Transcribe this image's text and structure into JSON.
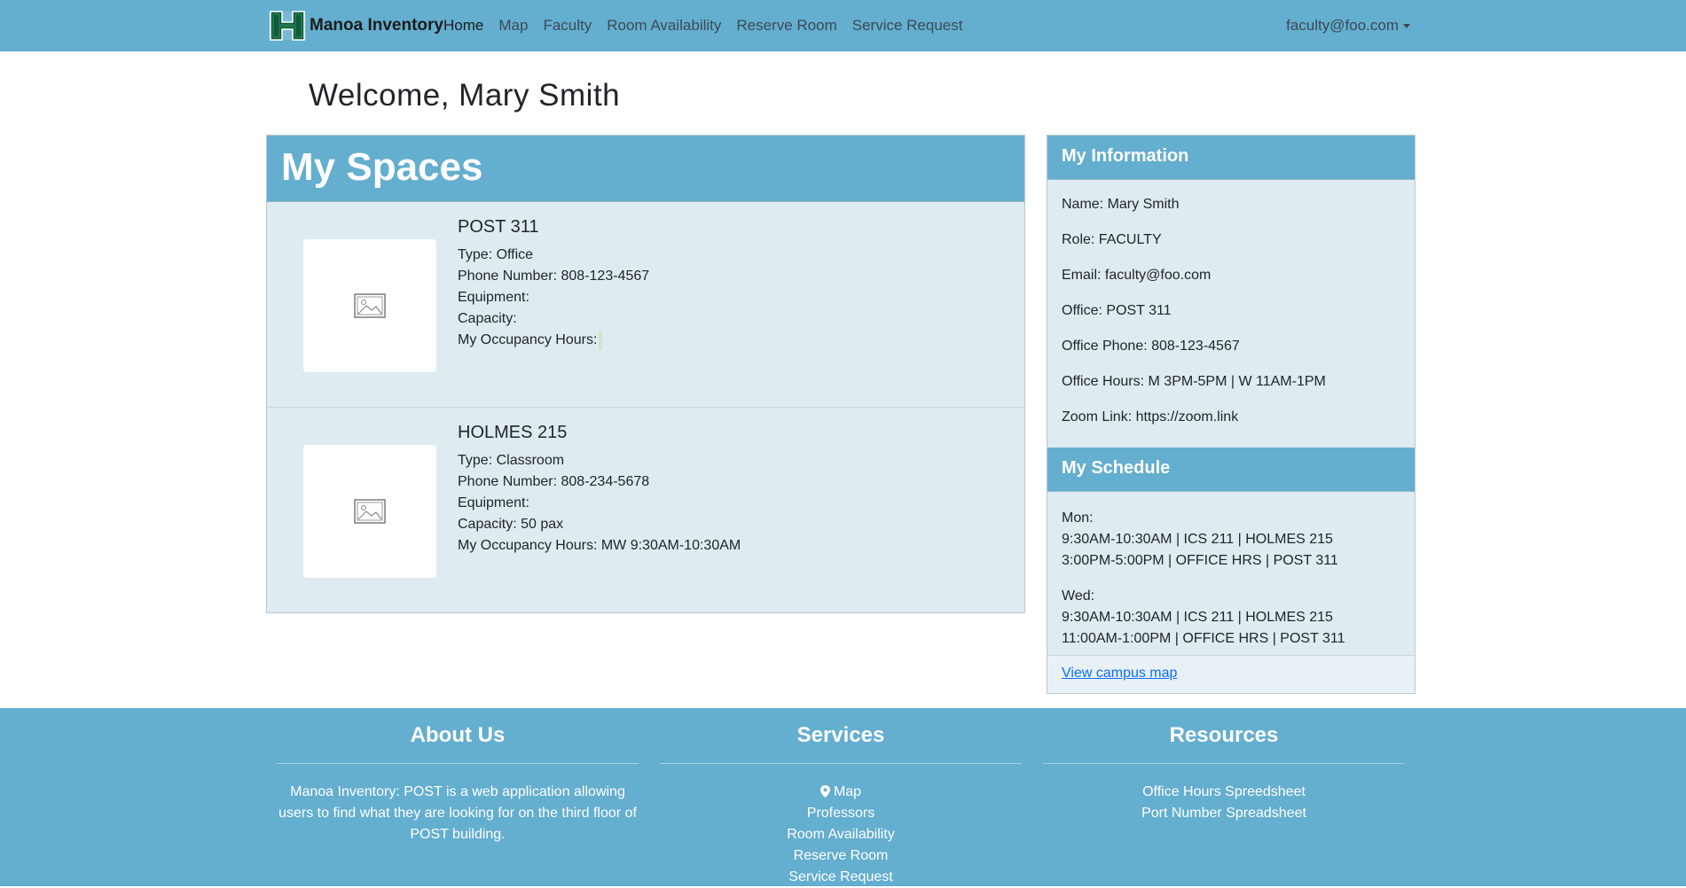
{
  "navbar": {
    "brand": "Manoa Inventory",
    "links": [
      "Home",
      "Map",
      "Faculty",
      "Room Availability",
      "Reserve Room",
      "Service Request"
    ],
    "user": "faculty@foo.com"
  },
  "welcome": "Welcome, Mary Smith",
  "spaces": {
    "title": "My Spaces",
    "items": [
      {
        "name": "POST 311",
        "type": "Type: Office",
        "phone": "Phone Number: 808-123-4567",
        "equipment": "Equipment:",
        "capacity": "Capacity:",
        "hours": "My Occupancy Hours:"
      },
      {
        "name": "HOLMES 215",
        "type": "Type: Classroom",
        "phone": "Phone Number: 808-234-5678",
        "equipment": "Equipment:",
        "capacity": "Capacity: 50 pax",
        "hours": "My Occupancy Hours: MW 9:30AM-10:30AM"
      }
    ]
  },
  "info": {
    "title": "My Information",
    "rows": [
      "Name: Mary Smith",
      "Role: FACULTY",
      "Email: faculty@foo.com",
      "Office: POST 311",
      "Office Phone: 808-123-4567",
      "Office Hours: M 3PM-5PM | W 11AM-1PM",
      "Zoom Link: https://zoom.link"
    ]
  },
  "schedule": {
    "title": "My Schedule",
    "days": [
      {
        "day": "Mon:",
        "lines": [
          "9:30AM-10:30AM | ICS 211 | HOLMES 215",
          "3:00PM-5:00PM | OFFICE HRS | POST 311"
        ]
      },
      {
        "day": "Wed:",
        "lines": [
          "9:30AM-10:30AM | ICS 211 | HOLMES 215",
          "11:00AM-1:00PM | OFFICE HRS | POST 311"
        ]
      }
    ]
  },
  "map_link": "View campus map",
  "footer": {
    "about": {
      "title": "About Us",
      "text": "Manoa Inventory: POST is a web application allowing users to find what they are looking for on the third floor of POST building."
    },
    "services": {
      "title": "Services",
      "links": [
        "Map",
        "Professors",
        "Room Availability",
        "Reserve Room",
        "Service Request"
      ]
    },
    "resources": {
      "title": "Resources",
      "links": [
        "Office Hours Spreedsheet",
        "Port Number Spreadsheet"
      ]
    }
  },
  "colors": {
    "primary": "#64aecf",
    "panel": "#deecf2",
    "link": "#0d6efd"
  }
}
